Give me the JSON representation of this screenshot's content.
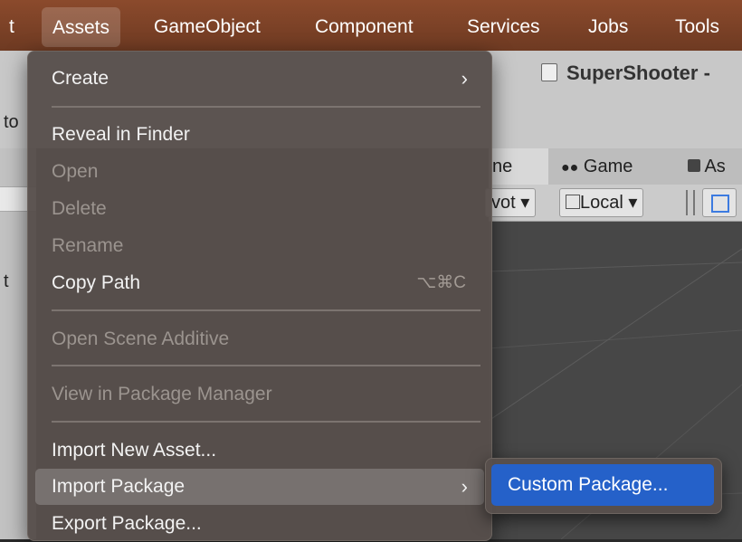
{
  "menubar": {
    "items": [
      "t",
      "Assets",
      "GameObject",
      "Component",
      "Services",
      "Jobs",
      "Tools"
    ],
    "active": "Assets"
  },
  "window": {
    "title": "SuperShooter -"
  },
  "left_panel": {
    "tab_cut": "to",
    "label_cut": "t"
  },
  "scene_view": {
    "tabs": [
      "ne",
      "Game",
      "As"
    ],
    "toolbar": {
      "pivot": "vot ▾",
      "local": "Local ▾"
    }
  },
  "menu": {
    "items": [
      {
        "label": "Create",
        "enabled": true,
        "submenu": true
      },
      {
        "label": "Reveal in Finder",
        "enabled": true
      },
      {
        "label": "Open",
        "enabled": false
      },
      {
        "label": "Delete",
        "enabled": false
      },
      {
        "label": "Rename",
        "enabled": false
      },
      {
        "label": "Copy Path",
        "enabled": true,
        "shortcut": "⌥⌘C"
      },
      {
        "label": "Open Scene Additive",
        "enabled": false
      },
      {
        "label": "View in Package Manager",
        "enabled": false
      },
      {
        "label": "Import New Asset...",
        "enabled": true
      },
      {
        "label": "Import Package",
        "enabled": true,
        "submenu": true,
        "highlighted": true
      },
      {
        "label": "Export Package...",
        "enabled": true
      }
    ]
  },
  "submenu": {
    "items": [
      {
        "label": "Custom Package...",
        "selected": true
      }
    ]
  },
  "colors": {
    "menubar": "#7d4127",
    "selection": "#2561c9",
    "menu_bg": "#58504c"
  }
}
